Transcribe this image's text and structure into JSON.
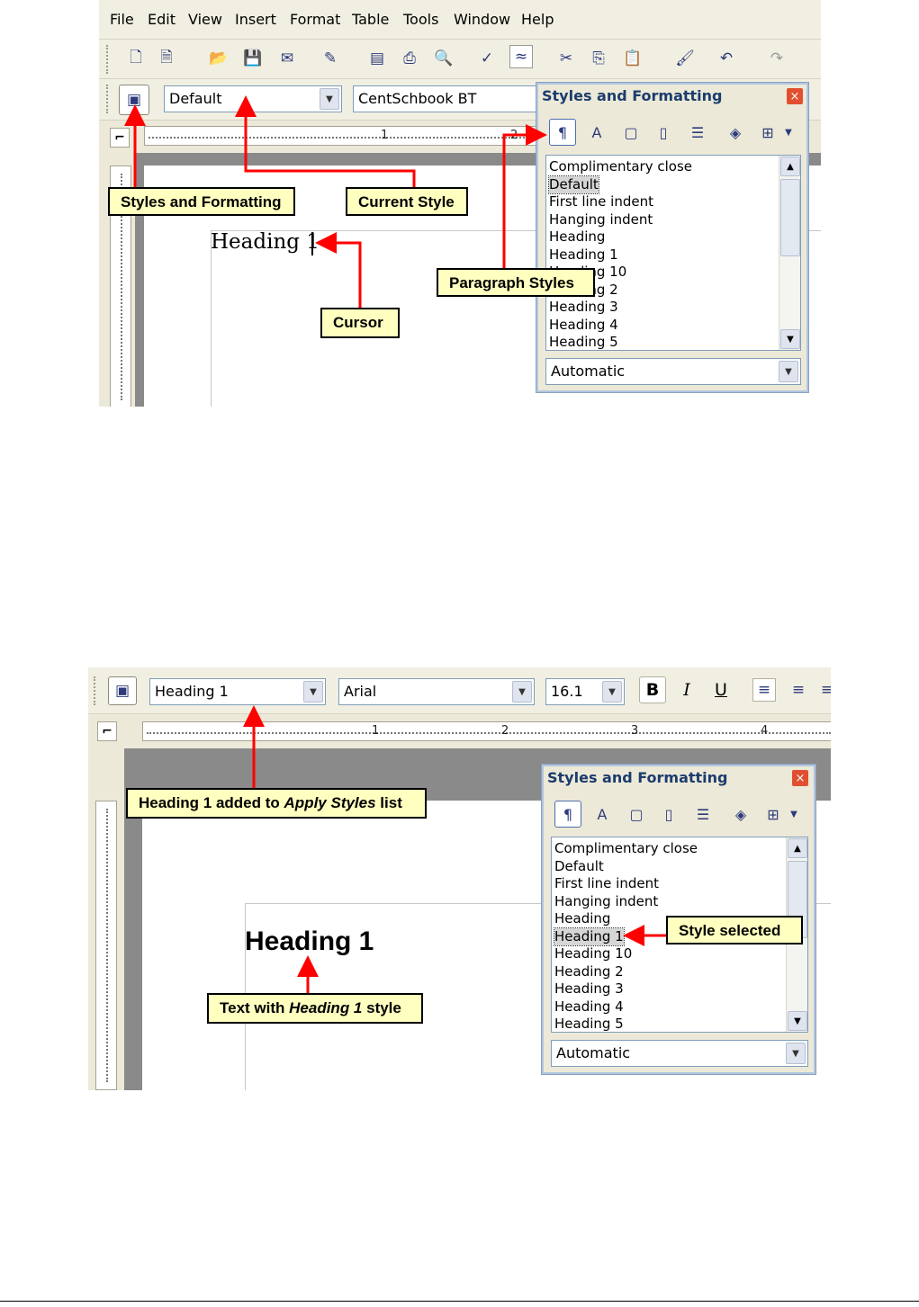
{
  "shot1": {
    "menu": [
      "File",
      "Edit",
      "View",
      "Insert",
      "Format",
      "Table",
      "Tools",
      "Window",
      "Help"
    ],
    "apply_style_value": "Default",
    "font_name_value": "CentSchbook BT",
    "ruler_numbers": [
      "1",
      "2"
    ],
    "doc_text": "Heading 1",
    "panel": {
      "title": "Styles and Formatting",
      "close": "×",
      "styles": [
        "Complimentary close",
        "Default",
        "First line indent",
        "Hanging indent",
        "Heading",
        "Heading 1",
        "Heading 10",
        "Heading 2",
        "Heading 3",
        "Heading 4",
        "Heading 5"
      ],
      "selected": "Default",
      "filter": "Automatic"
    },
    "callouts": {
      "styles_formatting": "Styles and Formatting",
      "current_style": "Current Style",
      "cursor": "Cursor",
      "paragraph_styles": "Paragraph Styles"
    }
  },
  "shot2": {
    "apply_style_value": "Heading 1",
    "font_name_value": "Arial",
    "font_size_value": "16.1",
    "format_buttons": {
      "bold": "B",
      "italic": "I",
      "underline": "U"
    },
    "ruler_numbers": [
      "1",
      "2",
      "3",
      "4"
    ],
    "doc_text": "Heading 1",
    "panel": {
      "title": "Styles and Formatting",
      "close": "×",
      "styles": [
        "Complimentary close",
        "Default",
        "First line indent",
        "Hanging indent",
        "Heading",
        "Heading 1",
        "Heading 10",
        "Heading 2",
        "Heading 3",
        "Heading 4",
        "Heading 5"
      ],
      "selected": "Heading 1",
      "filter": "Automatic"
    },
    "callouts": {
      "added_pre": "Heading 1 added to ",
      "added_em": "Apply Styles",
      "added_post": " list",
      "text_pre": "Text with ",
      "text_em": "Heading 1",
      "text_post": " style",
      "style_selected": "Style selected"
    }
  },
  "colors": {
    "callout_bg": "#ffffc0",
    "arrow": "#ff0000",
    "panel_title": "#1c3c6e"
  }
}
